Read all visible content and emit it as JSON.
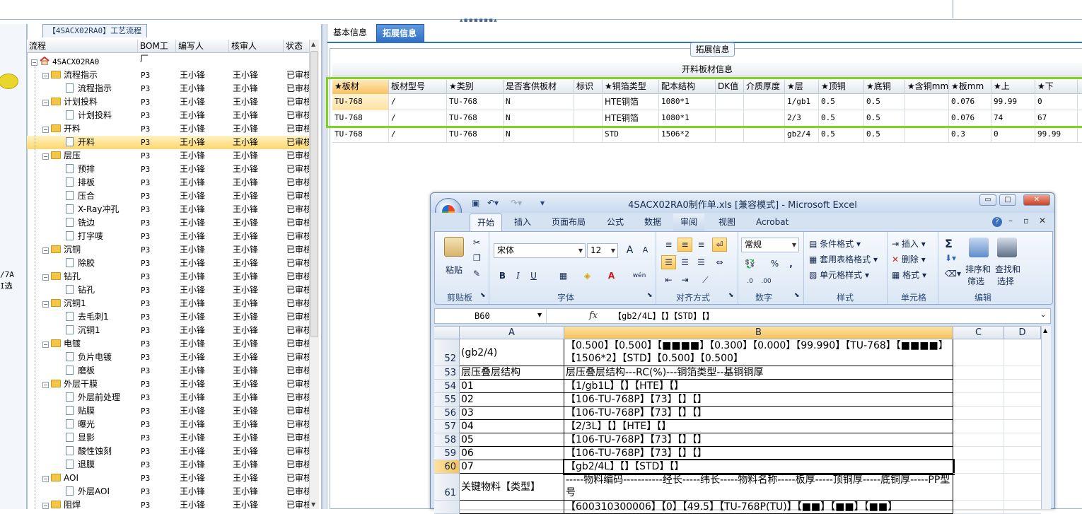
{
  "left_edge": {
    "cut_text_1": "/7A",
    "cut_text_2": "I选"
  },
  "flow_panel": {
    "tab_title": "【4SACX02RA0】工艺流程",
    "columns": [
      "流程",
      "BOM工厂",
      "编写人",
      "核审人",
      "状态"
    ],
    "root": "4SACX02RA0",
    "rows": [
      {
        "name": "流程指示",
        "level": 1,
        "type": "folder",
        "bom": "P3",
        "writer": "王小锋",
        "reviewer": "王小锋",
        "status": "已审核"
      },
      {
        "name": "流程指示",
        "level": 2,
        "type": "doc",
        "bom": "P3",
        "writer": "王小锋",
        "reviewer": "王小锋",
        "status": "已审核"
      },
      {
        "name": "计划投料",
        "level": 1,
        "type": "folder",
        "bom": "P3",
        "writer": "王小锋",
        "reviewer": "王小锋",
        "status": "已审核"
      },
      {
        "name": "计划投料",
        "level": 2,
        "type": "doc",
        "bom": "P3",
        "writer": "王小锋",
        "reviewer": "王小锋",
        "status": "已审核"
      },
      {
        "name": "开料",
        "level": 1,
        "type": "folder",
        "bom": "P3",
        "writer": "王小锋",
        "reviewer": "王小锋",
        "status": "已审核"
      },
      {
        "name": "开料",
        "level": 2,
        "type": "doc",
        "bom": "P3",
        "writer": "王小锋",
        "reviewer": "王小锋",
        "status": "已审核",
        "selected": true
      },
      {
        "name": "层压",
        "level": 1,
        "type": "folder",
        "bom": "P3",
        "writer": "王小锋",
        "reviewer": "王小锋",
        "status": "已审核"
      },
      {
        "name": "预排",
        "level": 2,
        "type": "doc",
        "bom": "P3",
        "writer": "王小锋",
        "reviewer": "王小锋",
        "status": "已审核"
      },
      {
        "name": "排板",
        "level": 2,
        "type": "doc",
        "bom": "P3",
        "writer": "王小锋",
        "reviewer": "王小锋",
        "status": "已审核"
      },
      {
        "name": "压合",
        "level": 2,
        "type": "doc",
        "bom": "P3",
        "writer": "王小锋",
        "reviewer": "王小锋",
        "status": "已审核"
      },
      {
        "name": "X-Ray冲孔",
        "level": 2,
        "type": "doc",
        "bom": "P3",
        "writer": "王小锋",
        "reviewer": "王小锋",
        "status": "已审核"
      },
      {
        "name": "铣边",
        "level": 2,
        "type": "doc",
        "bom": "P3",
        "writer": "王小锋",
        "reviewer": "王小锋",
        "status": "已审核"
      },
      {
        "name": "打字唛",
        "level": 2,
        "type": "doc",
        "bom": "P3",
        "writer": "王小锋",
        "reviewer": "王小锋",
        "status": "已审核"
      },
      {
        "name": "沉铜",
        "level": 1,
        "type": "folder",
        "bom": "P3",
        "writer": "王小锋",
        "reviewer": "王小锋",
        "status": "已审核"
      },
      {
        "name": "除胶",
        "level": 2,
        "type": "doc",
        "bom": "P3",
        "writer": "王小锋",
        "reviewer": "王小锋",
        "status": "已审核"
      },
      {
        "name": "钻孔",
        "level": 1,
        "type": "folder",
        "bom": "P3",
        "writer": "王小锋",
        "reviewer": "王小锋",
        "status": "已审核"
      },
      {
        "name": "钻孔",
        "level": 2,
        "type": "doc",
        "bom": "P3",
        "writer": "王小锋",
        "reviewer": "王小锋",
        "status": "已审核"
      },
      {
        "name": "沉铜1",
        "level": 1,
        "type": "folder",
        "bom": "P3",
        "writer": "王小锋",
        "reviewer": "王小锋",
        "status": "已审核"
      },
      {
        "name": "去毛刺1",
        "level": 2,
        "type": "doc",
        "bom": "P3",
        "writer": "王小锋",
        "reviewer": "王小锋",
        "status": "已审核"
      },
      {
        "name": "沉铜1",
        "level": 2,
        "type": "doc",
        "bom": "P3",
        "writer": "王小锋",
        "reviewer": "王小锋",
        "status": "已审核"
      },
      {
        "name": "电镀",
        "level": 1,
        "type": "folder",
        "bom": "P3",
        "writer": "王小锋",
        "reviewer": "王小锋",
        "status": "已审核"
      },
      {
        "name": "负片电镀",
        "level": 2,
        "type": "doc",
        "bom": "P3",
        "writer": "王小锋",
        "reviewer": "王小锋",
        "status": "已审核"
      },
      {
        "name": "磨板",
        "level": 2,
        "type": "doc",
        "bom": "P3",
        "writer": "王小锋",
        "reviewer": "王小锋",
        "status": "已审核"
      },
      {
        "name": "外层干膜",
        "level": 1,
        "type": "folder",
        "bom": "P3",
        "writer": "王小锋",
        "reviewer": "王小锋",
        "status": "已审核"
      },
      {
        "name": "外层前处理",
        "level": 2,
        "type": "doc",
        "bom": "P3",
        "writer": "王小锋",
        "reviewer": "王小锋",
        "status": "已审核"
      },
      {
        "name": "贴膜",
        "level": 2,
        "type": "doc",
        "bom": "P3",
        "writer": "王小锋",
        "reviewer": "王小锋",
        "status": "已审核"
      },
      {
        "name": "曝光",
        "level": 2,
        "type": "doc",
        "bom": "P3",
        "writer": "王小锋",
        "reviewer": "王小锋",
        "status": "已审核"
      },
      {
        "name": "显影",
        "level": 2,
        "type": "doc",
        "bom": "P3",
        "writer": "王小锋",
        "reviewer": "王小锋",
        "status": "已审核"
      },
      {
        "name": "酸性蚀刻",
        "level": 2,
        "type": "doc",
        "bom": "P3",
        "writer": "王小锋",
        "reviewer": "王小锋",
        "status": "已审核"
      },
      {
        "name": "退膜",
        "level": 2,
        "type": "doc",
        "bom": "P3",
        "writer": "王小锋",
        "reviewer": "王小锋",
        "status": "已审核"
      },
      {
        "name": "AOI",
        "level": 1,
        "type": "folder",
        "bom": "P3",
        "writer": "王小锋",
        "reviewer": "王小锋",
        "status": "已审核"
      },
      {
        "name": "外层AOI",
        "level": 2,
        "type": "doc",
        "bom": "P3",
        "writer": "王小锋",
        "reviewer": "王小锋",
        "status": "已审核"
      },
      {
        "name": "阻焊",
        "level": 1,
        "type": "folder",
        "bom": "P3",
        "writer": "王小锋",
        "reviewer": "王小锋",
        "status": "已审核"
      }
    ]
  },
  "right_panel": {
    "tabs": [
      "基本信息",
      "拓展信息"
    ],
    "active_tab": "拓展信息",
    "group_title": "拓展信息",
    "grid_caption": "开料板材信息",
    "grid_columns": [
      "★板材",
      "板材型号",
      "★类别",
      "是否客供板材",
      "标识",
      "★铜箔类型",
      "配本结构",
      "DK值",
      "介质厚度",
      "★层",
      "★顶铜",
      "★底铜",
      "★含铜mm",
      "★板mm",
      "★上",
      "★下"
    ],
    "grid_rows": [
      [
        "TU-768",
        "/",
        "TU-768",
        "N",
        "",
        "HTE铜箔",
        "1080*1",
        "",
        "",
        "1/gb1",
        "0.5",
        "0.5",
        "",
        "0.076",
        "99.99",
        "0"
      ],
      [
        "TU-768",
        "/",
        "TU-768",
        "N",
        "",
        "HTE铜箔",
        "1080*1",
        "",
        "",
        "2/3",
        "0.5",
        "0.5",
        "",
        "0.076",
        "74",
        "67"
      ],
      [
        "TU-768",
        "/",
        "TU-768",
        "N",
        "",
        "STD",
        "1506*2",
        "",
        "",
        "gb2/4",
        "0.5",
        "0.5",
        "",
        "0.3",
        "0",
        "99.99"
      ]
    ],
    "highlight_color": "#7ed321"
  },
  "excel": {
    "title": "4SACX02RA0制作单.xls  [兼容模式] - Microsoft Excel",
    "tabs": [
      "开始",
      "插入",
      "页面布局",
      "公式",
      "数据",
      "审阅",
      "视图",
      "Acrobat"
    ],
    "active_tab": "开始",
    "ribbon": {
      "clipboard": {
        "paste": "粘贴",
        "label": "剪贴板"
      },
      "font": {
        "name": "宋体",
        "size": "12",
        "label": "字体",
        "bold": "B",
        "italic": "I",
        "underline": "U",
        "grow": "A",
        "shrink": "A",
        "wen": "wén"
      },
      "alignment": {
        "label": "对齐方式"
      },
      "number": {
        "format": "常规",
        "percent": "%",
        "comma": ",",
        "label": "数字"
      },
      "styles": {
        "conditional": "条件格式",
        "table": "套用表格格式",
        "cell": "单元格样式",
        "label": "样式"
      },
      "cells": {
        "insert": "插入",
        "delete": "删除",
        "format": "格式",
        "label": "单元格"
      },
      "editing": {
        "sigma": "Σ",
        "sort": "排序和",
        "sort2": "筛选",
        "find": "查找和",
        "find2": "选择",
        "label": "编辑"
      }
    },
    "name_box": "B60",
    "fx": "fx",
    "formula": "【gb2/4L】【】【STD】【】",
    "columns": [
      "A",
      "B",
      "C",
      "D"
    ],
    "rows": [
      {
        "num": "52",
        "a": "(gb2/4)",
        "b": "【0.500】【0.500】【■■■■】【0.300】【0.000】【99.990】【TU-768】【■■■■】【1506*2】【STD】【0.500】【0.500】",
        "tall": true
      },
      {
        "num": "53",
        "a": "层压叠层结构",
        "b": "层压叠层结构---RC(%)---铜箔类型--基铜铜厚"
      },
      {
        "num": "54",
        "a": "01",
        "b": "【1/gb1L】【】【HTE】【】"
      },
      {
        "num": "55",
        "a": "02",
        "b": "【106-TU-768P】【73】【】【】"
      },
      {
        "num": "56",
        "a": "03",
        "b": "【106-TU-768P】【73】【】【】"
      },
      {
        "num": "57",
        "a": "04",
        "b": "【2/3L】【】【HTE】【】"
      },
      {
        "num": "58",
        "a": "05",
        "b": "【106-TU-768P】【73】【】【】"
      },
      {
        "num": "59",
        "a": "06",
        "b": "【106-TU-768P】【73】【】【】"
      },
      {
        "num": "60",
        "a": "07",
        "b": "【gb2/4L】【】【STD】【】",
        "active": true
      },
      {
        "num": "61",
        "a": "关键物料【类型】",
        "b": "-----物料编码-----------经长-----纬长-----物料名称-----板厚-----顶铜厚-----底铜厚-----PP型号",
        "tall": true
      },
      {
        "num": "",
        "a": "",
        "b": "【600310300006】【0】【49.5】【TU-768P(TU)】【■■】【■■】【■■】"
      }
    ]
  }
}
